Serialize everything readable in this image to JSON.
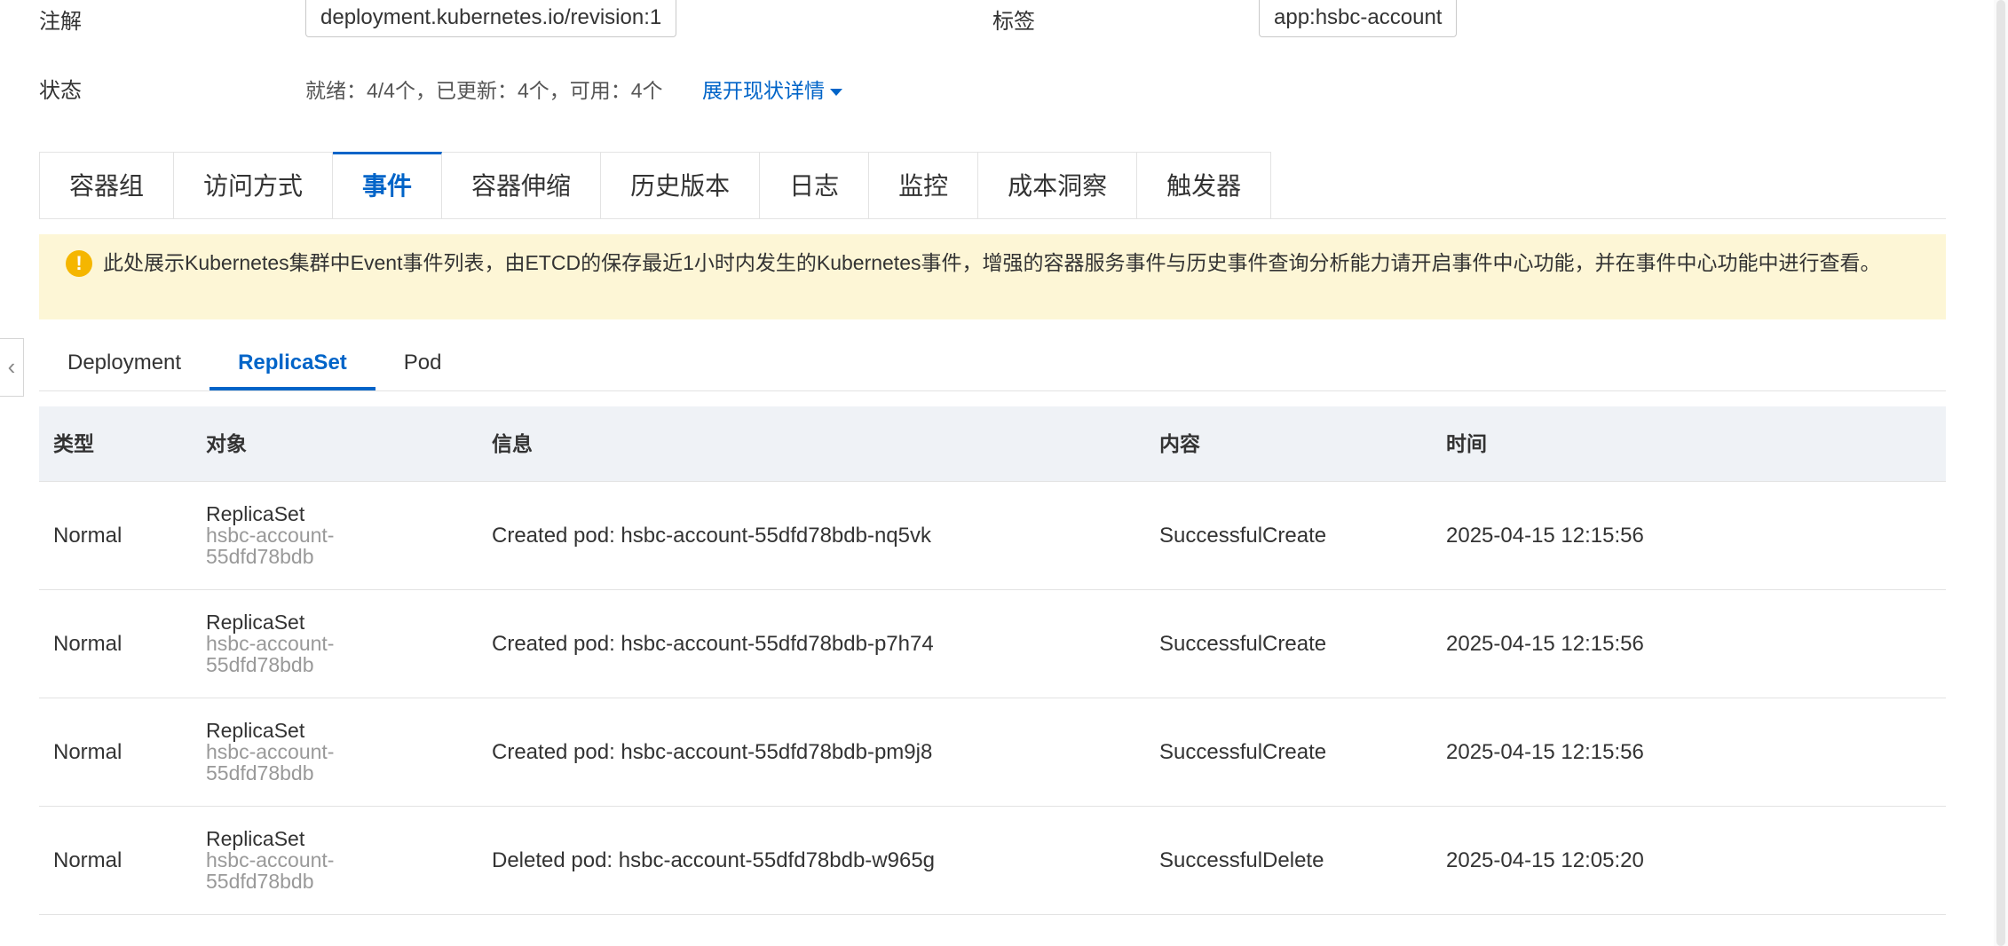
{
  "meta": {
    "annotation_label": "注解",
    "annotation_value": "deployment.kubernetes.io/revision:1",
    "labels_label": "标签",
    "labels_value": "app:hsbc-account",
    "status_label": "状态",
    "status_value": "就绪：4/4个，已更新：4个，可用：4个",
    "expand_link": "展开现状详情"
  },
  "main_tabs": [
    {
      "label": "容器组"
    },
    {
      "label": "访问方式"
    },
    {
      "label": "事件",
      "active": true
    },
    {
      "label": "容器伸缩"
    },
    {
      "label": "历史版本"
    },
    {
      "label": "日志"
    },
    {
      "label": "监控"
    },
    {
      "label": "成本洞察"
    },
    {
      "label": "触发器"
    }
  ],
  "notice": {
    "icon": "exclamation-icon",
    "text": "此处展示Kubernetes集群中Event事件列表，由ETCD的保存最近1小时内发生的Kubernetes事件，增强的容器服务事件与历史事件查询分析能力请开启事件中心功能，并在事件中心功能中进行查看。"
  },
  "sub_tabs": [
    {
      "label": "Deployment"
    },
    {
      "label": "ReplicaSet",
      "active": true
    },
    {
      "label": "Pod"
    }
  ],
  "table": {
    "headers": [
      "类型",
      "对象",
      "信息",
      "内容",
      "时间"
    ],
    "rows": [
      {
        "type": "Normal",
        "object_kind": "ReplicaSet",
        "object_name_1": "hsbc-account-",
        "object_name_2": "55dfd78bdb",
        "message": "Created pod: hsbc-account-55dfd78bdb-nq5vk",
        "reason": "SuccessfulCreate",
        "time": "2025-04-15 12:15:56"
      },
      {
        "type": "Normal",
        "object_kind": "ReplicaSet",
        "object_name_1": "hsbc-account-",
        "object_name_2": "55dfd78bdb",
        "message": "Created pod: hsbc-account-55dfd78bdb-p7h74",
        "reason": "SuccessfulCreate",
        "time": "2025-04-15 12:15:56"
      },
      {
        "type": "Normal",
        "object_kind": "ReplicaSet",
        "object_name_1": "hsbc-account-",
        "object_name_2": "55dfd78bdb",
        "message": "Created pod: hsbc-account-55dfd78bdb-pm9j8",
        "reason": "SuccessfulCreate",
        "time": "2025-04-15 12:15:56"
      },
      {
        "type": "Normal",
        "object_kind": "ReplicaSet",
        "object_name_1": "hsbc-account-",
        "object_name_2": "55dfd78bdb",
        "message": "Deleted pod: hsbc-account-55dfd78bdb-w965g",
        "reason": "SuccessfulDelete",
        "time": "2025-04-15 12:05:20"
      }
    ]
  },
  "colors": {
    "accent": "#0064c8",
    "notice_bg": "#fdf6d6",
    "notice_icon": "#f5b600",
    "table_header_bg": "#eff2f6"
  },
  "icons": {
    "side_toggle": "chevron-left-icon",
    "expand_caret": "caret-down-icon"
  }
}
